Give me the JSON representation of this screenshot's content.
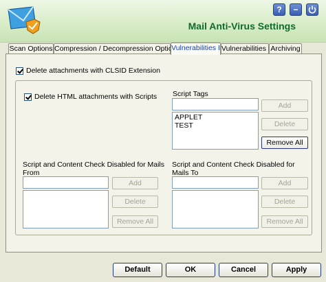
{
  "window": {
    "title": "Mail Anti-Virus Settings"
  },
  "header_buttons": {
    "help": "?",
    "minimize": "−"
  },
  "tabs": [
    {
      "label": "Scan Options"
    },
    {
      "label": "Compression / Decompression Options"
    },
    {
      "label": "Vulnerabilities I"
    },
    {
      "label": "Vulnerabilities II"
    },
    {
      "label": "Archiving"
    }
  ],
  "active_tab": "Vulnerabilities I",
  "options": {
    "delete_clsid": {
      "label": "Delete attachments with CLSID Extension",
      "checked": true
    },
    "delete_html": {
      "label": "Delete HTML attachments with Scripts",
      "checked": true
    }
  },
  "script_tags": {
    "label": "Script Tags",
    "input_value": "",
    "items": [
      "APPLET",
      "TEST"
    ],
    "add_label": "Add",
    "delete_label": "Delete",
    "remove_all_label": "Remove All"
  },
  "from_list": {
    "label": "Script and Content Check Disabled for Mails From",
    "input_value": "",
    "items": [],
    "add_label": "Add",
    "delete_label": "Delete",
    "remove_all_label": "Remove All"
  },
  "to_list": {
    "label": "Script and Content Check Disabled for Mails To",
    "input_value": "",
    "items": [],
    "add_label": "Add",
    "delete_label": "Delete",
    "remove_all_label": "Remove All"
  },
  "footer": {
    "default_label": "Default",
    "ok_label": "OK",
    "cancel_label": "Cancel",
    "apply_label": "Apply"
  },
  "colors": {
    "title": "#0f6a2e",
    "active_tab": "#1a3fa8",
    "header_bg": "#d7ecc6"
  }
}
